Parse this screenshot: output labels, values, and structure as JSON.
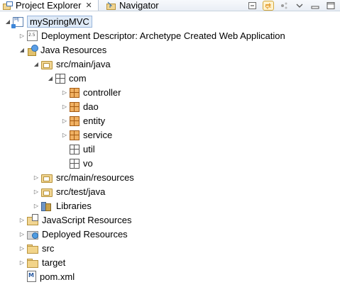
{
  "tabs": [
    {
      "label": "Project Explorer",
      "close": "✕",
      "active": true
    },
    {
      "label": "Navigator",
      "active": false
    }
  ],
  "tree": [
    {
      "label": "mySpringMVC",
      "icon": "maven-web-project-icon",
      "depth": 0,
      "twisty": "expanded",
      "selected": true
    },
    {
      "label": "Deployment Descriptor: Archetype Created Web Application",
      "icon": "deployment-descriptor-icon",
      "depth": 1,
      "twisty": "collapsed"
    },
    {
      "label": "Java Resources",
      "icon": "java-resources-icon",
      "depth": 1,
      "twisty": "expanded"
    },
    {
      "label": "src/main/java",
      "icon": "source-folder-icon",
      "depth": 2,
      "twisty": "expanded"
    },
    {
      "label": "com",
      "icon": "empty-package-icon",
      "depth": 3,
      "twisty": "expanded"
    },
    {
      "label": "controller",
      "icon": "package-icon",
      "depth": 4,
      "twisty": "collapsed"
    },
    {
      "label": "dao",
      "icon": "package-icon",
      "depth": 4,
      "twisty": "collapsed"
    },
    {
      "label": "entity",
      "icon": "package-icon",
      "depth": 4,
      "twisty": "collapsed"
    },
    {
      "label": "service",
      "icon": "package-icon",
      "depth": 4,
      "twisty": "collapsed"
    },
    {
      "label": "util",
      "icon": "empty-package-icon",
      "depth": 4,
      "twisty": "none"
    },
    {
      "label": "vo",
      "icon": "empty-package-icon",
      "depth": 4,
      "twisty": "none"
    },
    {
      "label": "src/main/resources",
      "icon": "source-folder-icon",
      "depth": 2,
      "twisty": "collapsed"
    },
    {
      "label": "src/test/java",
      "icon": "source-folder-icon",
      "depth": 2,
      "twisty": "collapsed"
    },
    {
      "label": "Libraries",
      "icon": "libraries-icon",
      "depth": 2,
      "twisty": "collapsed"
    },
    {
      "label": "JavaScript Resources",
      "icon": "javascript-resources-icon",
      "depth": 1,
      "twisty": "collapsed"
    },
    {
      "label": "Deployed Resources",
      "icon": "deployed-resources-icon",
      "depth": 1,
      "twisty": "collapsed"
    },
    {
      "label": "src",
      "icon": "folder-icon",
      "depth": 1,
      "twisty": "collapsed"
    },
    {
      "label": "target",
      "icon": "folder-icon",
      "depth": 1,
      "twisty": "collapsed"
    },
    {
      "label": "pom.xml",
      "icon": "maven-xml-icon",
      "depth": 1,
      "twisty": "none"
    }
  ]
}
